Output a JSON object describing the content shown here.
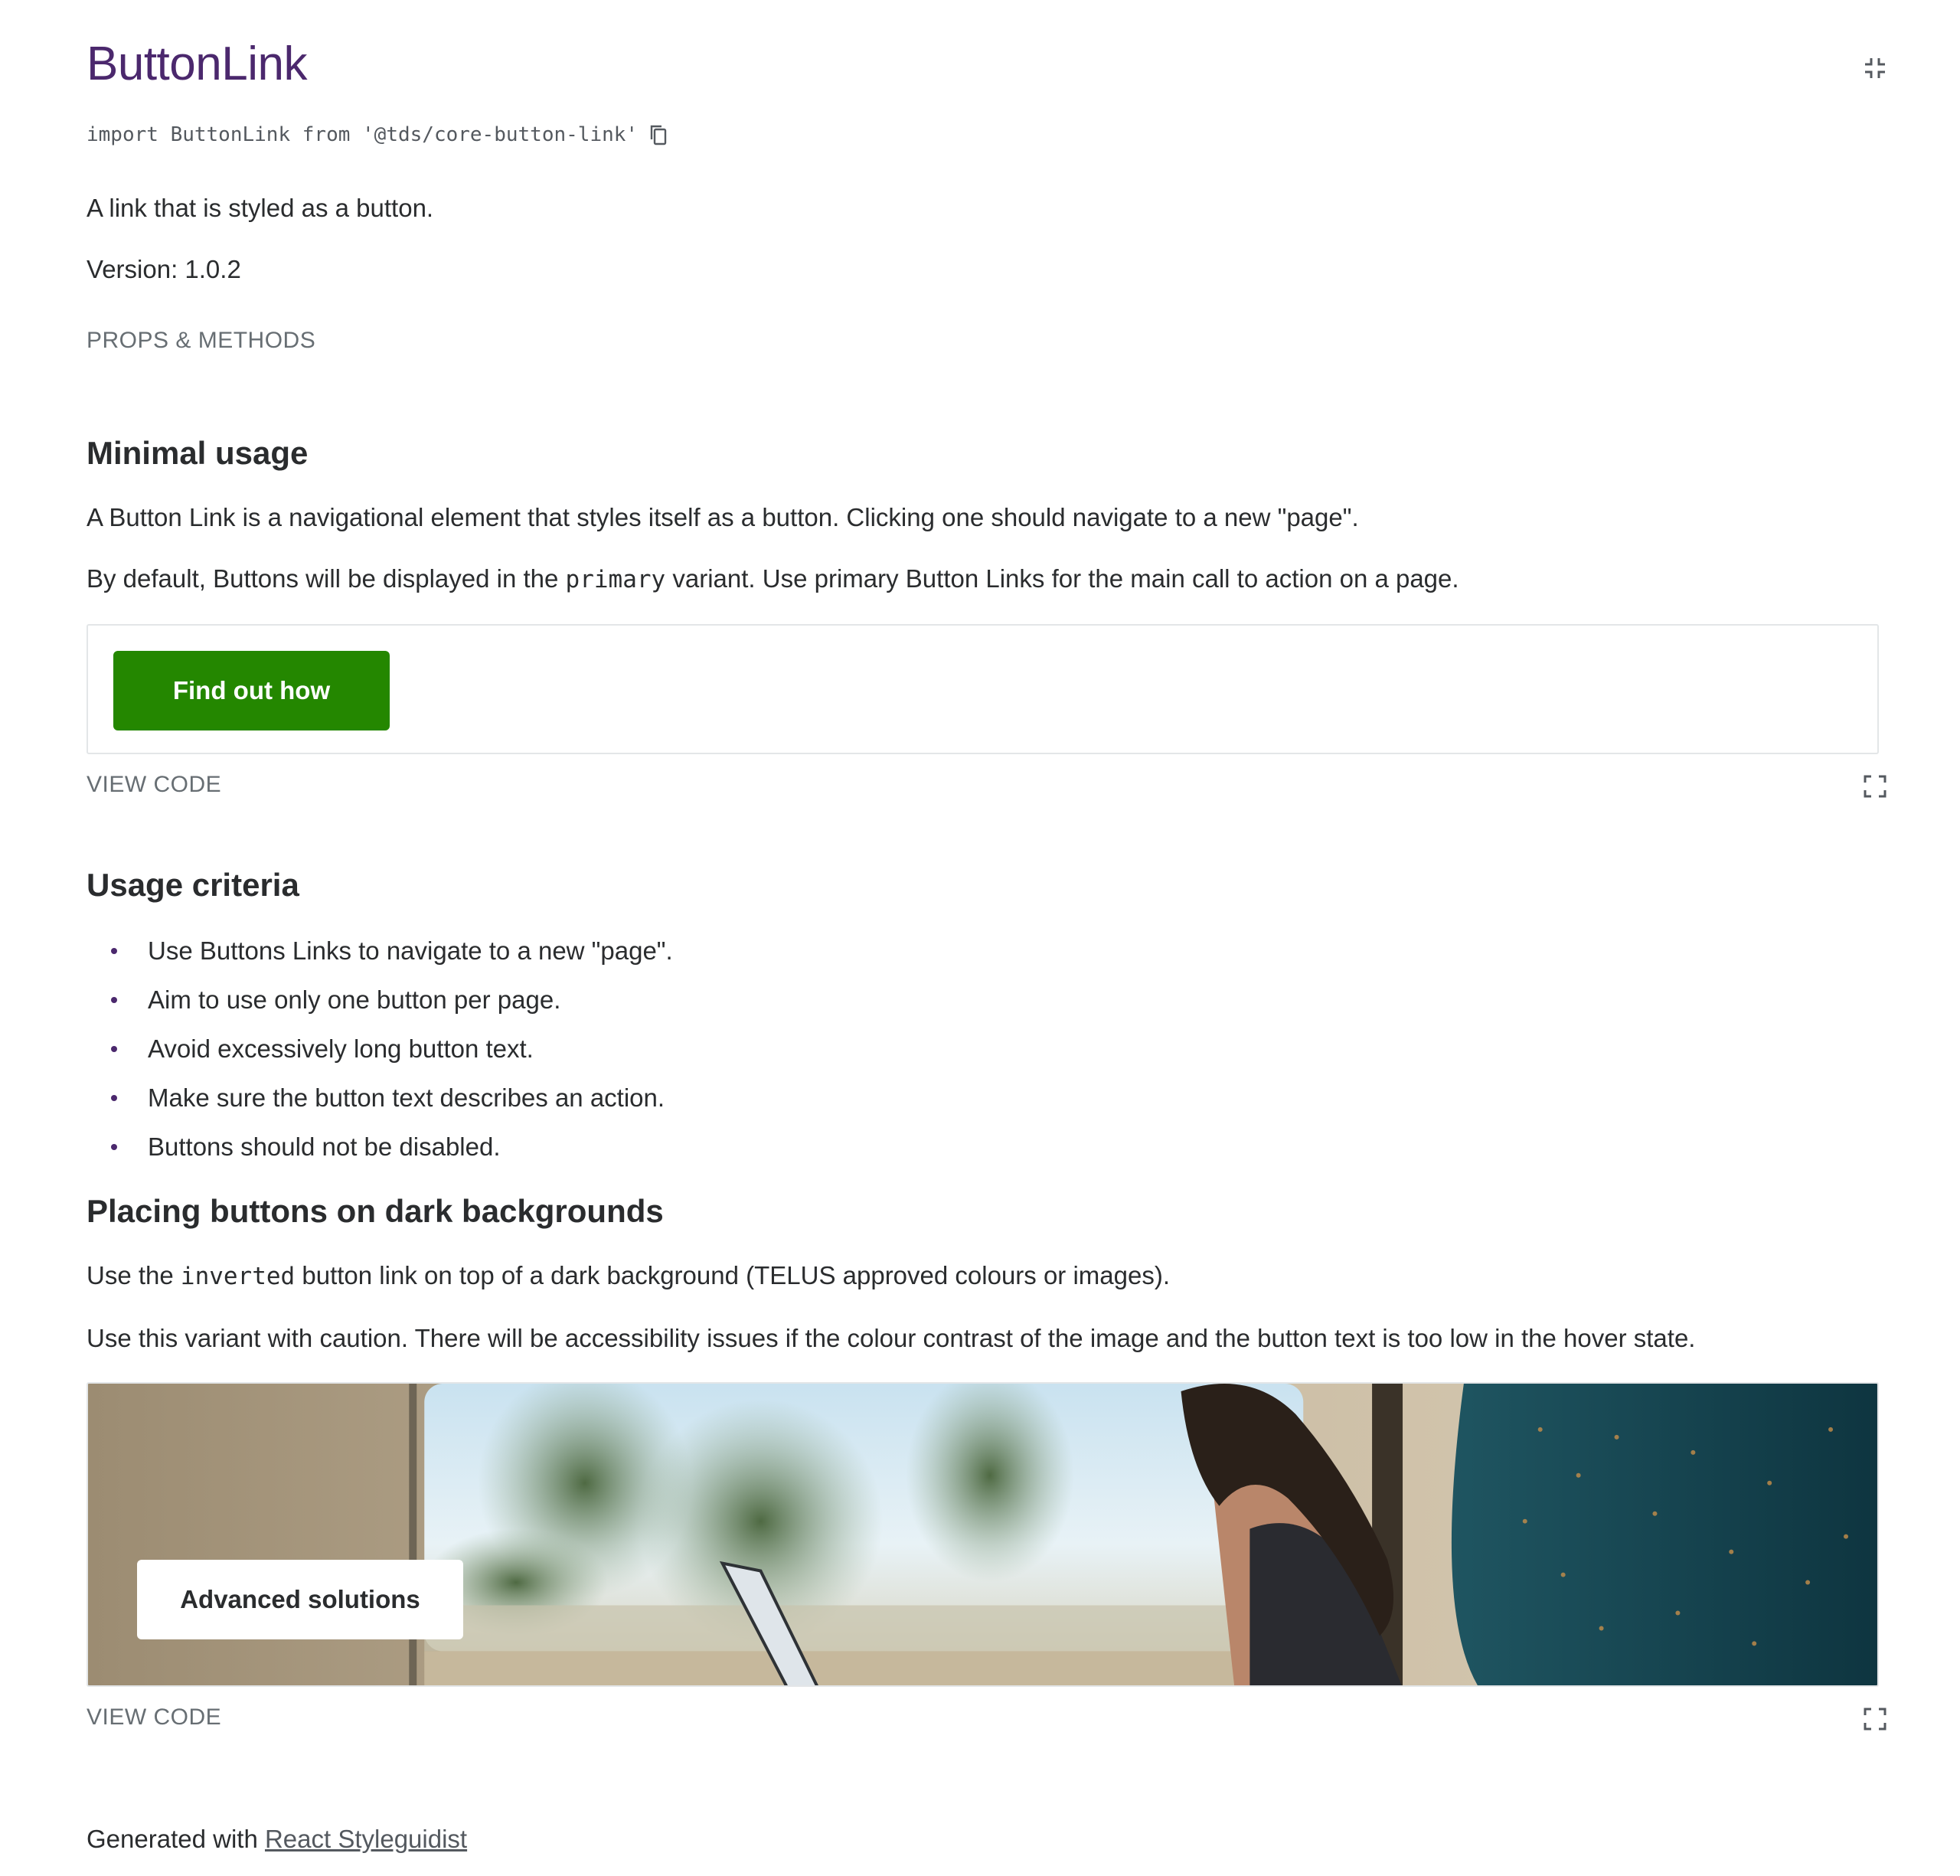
{
  "header": {
    "title": "ButtonLink",
    "import_statement": "import ButtonLink from '@tds/core-button-link'",
    "description": "A link that is styled as a button.",
    "version": "Version: 1.0.2",
    "props_link": "PROPS & METHODS"
  },
  "minimal_usage": {
    "heading": "Minimal usage",
    "para1": "A Button Link is a navigational element that styles itself as a button. Clicking one should navigate to a new \"page\".",
    "para2_before": "By default, Buttons will be displayed in the ",
    "para2_code": "primary",
    "para2_after": " variant. Use primary Button Links for the main call to action on a page.",
    "button_label": "Find out how",
    "button_color": "#248700",
    "view_code": "VIEW CODE"
  },
  "usage_criteria": {
    "heading": "Usage criteria",
    "items": [
      "Use Buttons Links to navigate to a new \"page\".",
      "Aim to use only one button per page.",
      "Avoid excessively long button text.",
      "Make sure the button text describes an action.",
      "Buttons should not be disabled."
    ]
  },
  "dark_backgrounds": {
    "heading": "Placing buttons on dark backgrounds",
    "para1_before": "Use the ",
    "para1_code": "inverted",
    "para1_after": " button link on top of a dark background (TELUS approved colours or images).",
    "para2": "Use this variant with caution. There will be accessibility issues if the colour contrast of the image and the button text is too low in the hover state.",
    "button_label": "Advanced solutions",
    "view_code": "VIEW CODE"
  },
  "footer": {
    "prefix": "Generated with ",
    "link_text": "React Styleguidist"
  },
  "colors": {
    "title": "#4b286d",
    "primary_button": "#248700",
    "text": "#2a2c2e",
    "muted": "#676e73"
  },
  "icons": {
    "collapse": "collapse-icon",
    "copy": "copy-icon",
    "expand": "expand-icon"
  }
}
